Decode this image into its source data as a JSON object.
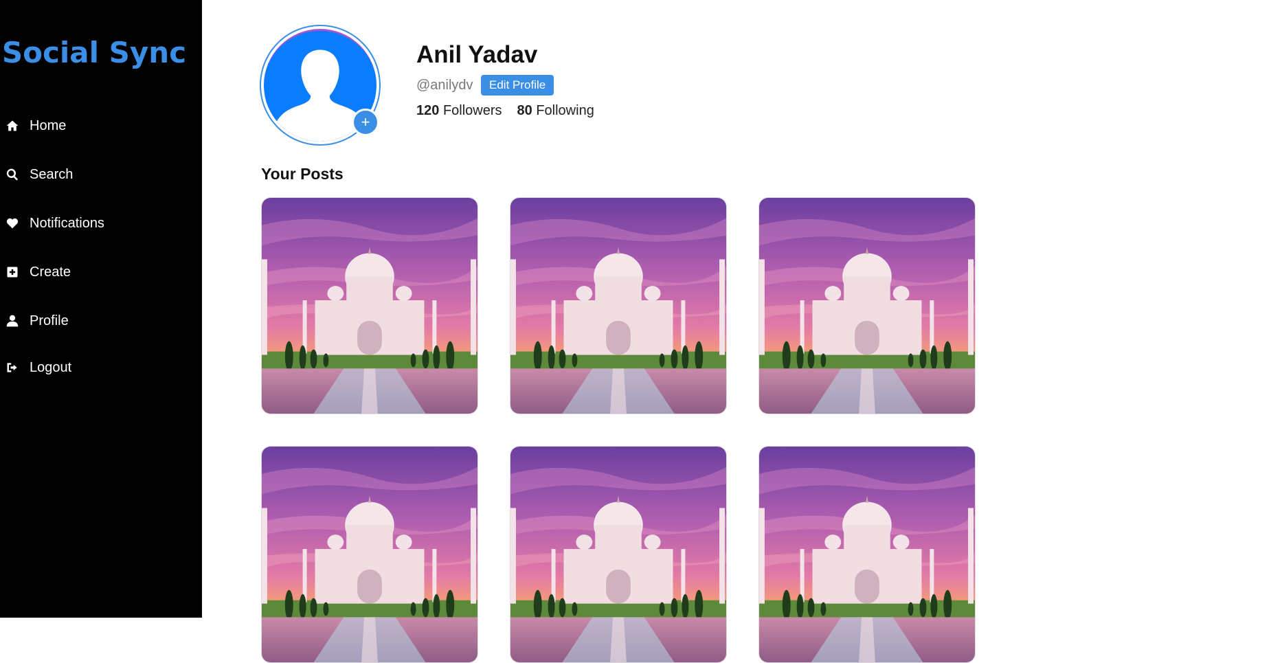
{
  "app": {
    "title": "Social Sync"
  },
  "sidebar": {
    "items": [
      {
        "label": "Home",
        "icon": "home-icon"
      },
      {
        "label": "Search",
        "icon": "search-icon"
      },
      {
        "label": "Notifications",
        "icon": "heart-icon"
      },
      {
        "label": "Create",
        "icon": "plus-square-icon"
      },
      {
        "label": "Profile",
        "icon": "user-icon"
      },
      {
        "label": "Logout",
        "icon": "logout-icon"
      }
    ]
  },
  "profile": {
    "name": "Anil Yadav",
    "handle": "@anilydv",
    "edit_label": "Edit Profile",
    "add_photo_glyph": "+",
    "followers_count": "120",
    "followers_label": "Followers",
    "following_count": "80",
    "following_label": "Following"
  },
  "posts": {
    "title": "Your Posts",
    "items": [
      {
        "image": "taj-mahal-sunset"
      },
      {
        "image": "taj-mahal-sunset"
      },
      {
        "image": "taj-mahal-sunset"
      },
      {
        "image": "taj-mahal-sunset"
      },
      {
        "image": "taj-mahal-sunset"
      },
      {
        "image": "taj-mahal-sunset"
      }
    ]
  },
  "colors": {
    "accent": "#3a8ee6",
    "sidebar_bg": "#000000",
    "avatar_bg": "#0a7cff"
  }
}
